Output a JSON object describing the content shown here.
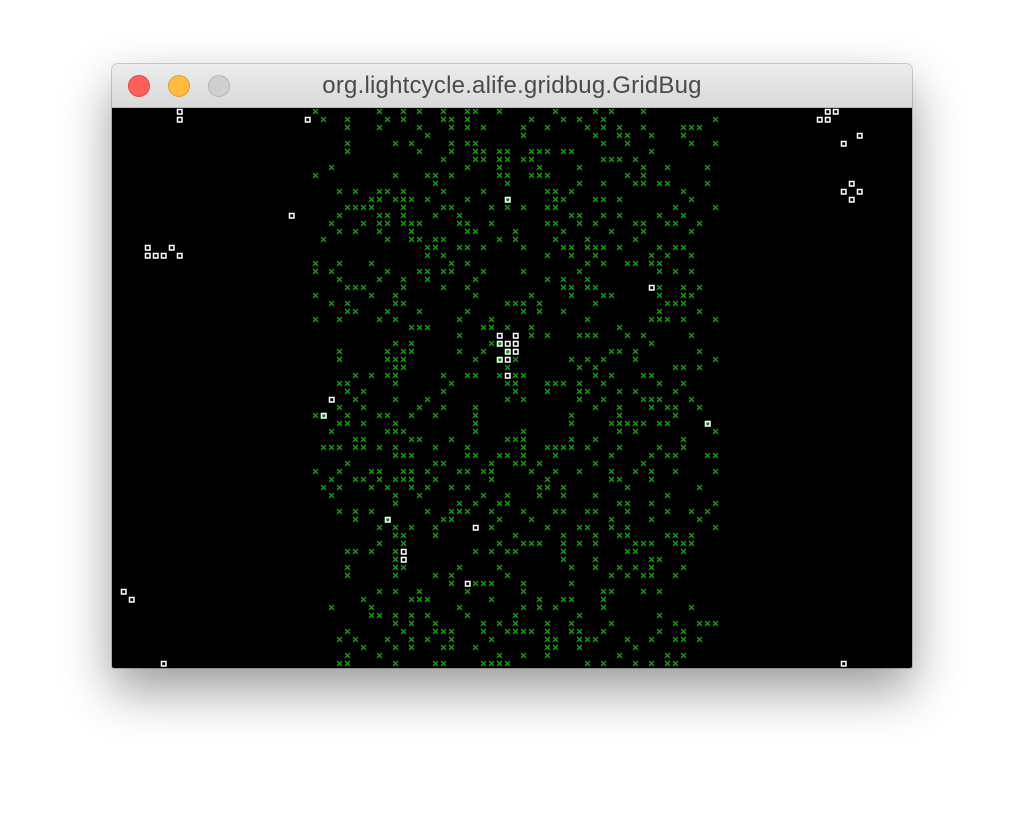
{
  "window": {
    "title": "org.lightcycle.alife.gridbug.GridBug",
    "buttons": {
      "close": "close-button",
      "minimize": "minimize-button",
      "zoom": "zoom-button"
    }
  },
  "colors": {
    "background": "#000000",
    "food": "#1f9b1f",
    "bug": "#ffffff"
  }
}
